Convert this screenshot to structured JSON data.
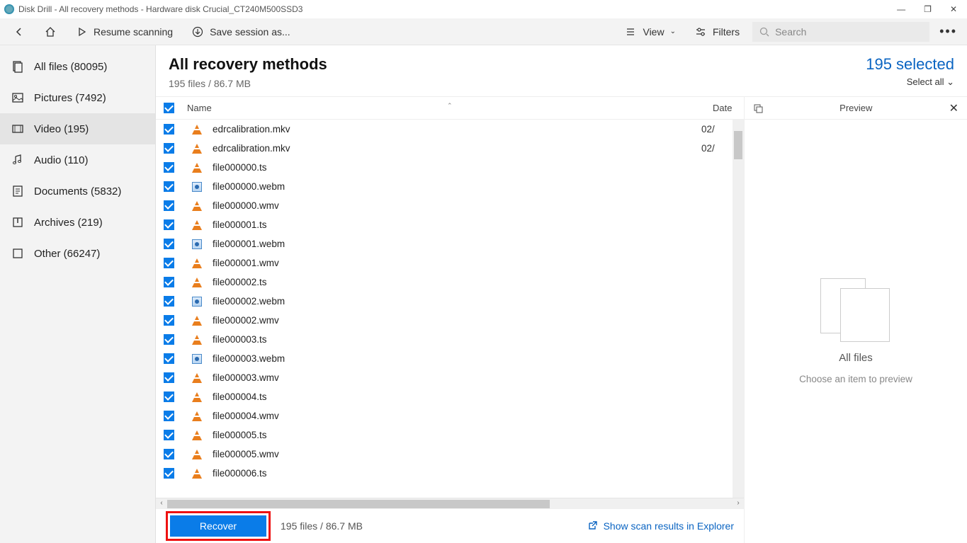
{
  "window": {
    "title": "Disk Drill - All recovery methods - Hardware disk Crucial_CT240M500SSD3"
  },
  "toolbar": {
    "resume": "Resume scanning",
    "save": "Save session as...",
    "view": "View",
    "filters": "Filters",
    "search_placeholder": "Search"
  },
  "sidebar": {
    "items": [
      {
        "label": "All files (80095)"
      },
      {
        "label": "Pictures (7492)"
      },
      {
        "label": "Video (195)"
      },
      {
        "label": "Audio (110)"
      },
      {
        "label": "Documents (5832)"
      },
      {
        "label": "Archives (219)"
      },
      {
        "label": "Other (66247)"
      }
    ]
  },
  "main": {
    "title": "All recovery methods",
    "subtitle": "195 files / 86.7 MB",
    "selected": "195 selected",
    "selectall": "Select all  ⌄"
  },
  "columns": {
    "name": "Name",
    "date": "Date"
  },
  "files": [
    {
      "name": "edrcalibration.mkv",
      "icon": "vlc",
      "date": "02/"
    },
    {
      "name": "edrcalibration.mkv",
      "icon": "vlc",
      "date": "02/"
    },
    {
      "name": "file000000.ts",
      "icon": "vlc",
      "date": ""
    },
    {
      "name": "file000000.webm",
      "icon": "webm",
      "date": ""
    },
    {
      "name": "file000000.wmv",
      "icon": "vlc",
      "date": ""
    },
    {
      "name": "file000001.ts",
      "icon": "vlc",
      "date": ""
    },
    {
      "name": "file000001.webm",
      "icon": "webm",
      "date": ""
    },
    {
      "name": "file000001.wmv",
      "icon": "vlc",
      "date": ""
    },
    {
      "name": "file000002.ts",
      "icon": "vlc",
      "date": ""
    },
    {
      "name": "file000002.webm",
      "icon": "webm",
      "date": ""
    },
    {
      "name": "file000002.wmv",
      "icon": "vlc",
      "date": ""
    },
    {
      "name": "file000003.ts",
      "icon": "vlc",
      "date": ""
    },
    {
      "name": "file000003.webm",
      "icon": "webm",
      "date": ""
    },
    {
      "name": "file000003.wmv",
      "icon": "vlc",
      "date": ""
    },
    {
      "name": "file000004.ts",
      "icon": "vlc",
      "date": ""
    },
    {
      "name": "file000004.wmv",
      "icon": "vlc",
      "date": ""
    },
    {
      "name": "file000005.ts",
      "icon": "vlc",
      "date": ""
    },
    {
      "name": "file000005.wmv",
      "icon": "vlc",
      "date": ""
    },
    {
      "name": "file000006.ts",
      "icon": "vlc",
      "date": ""
    }
  ],
  "footer": {
    "recover": "Recover",
    "stat": "195 files / 86.7 MB",
    "explorer": "Show scan results in Explorer"
  },
  "preview": {
    "title": "Preview",
    "heading": "All files",
    "sub": "Choose an item to preview"
  }
}
